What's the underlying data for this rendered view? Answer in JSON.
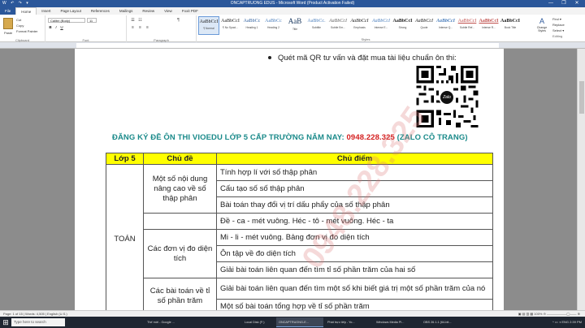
{
  "window": {
    "title": "ONCAPTRUONG EDUS  -  Microsoft Word (Product Activation Failed)",
    "quick_access": "W ↶ ↷ ▾",
    "min": "—",
    "max": "❐",
    "close": "✕"
  },
  "ribbon_tabs": [
    "File",
    "Home",
    "Insert",
    "Page Layout",
    "References",
    "Mailings",
    "Review",
    "View",
    "Foxit PDF"
  ],
  "ribbon": {
    "clipboard": {
      "label": "Clipboard",
      "paste": "Paste",
      "cut": "Cut",
      "copy": "Copy",
      "format_painter": "Format Painter"
    },
    "font": {
      "label": "Font",
      "name": "Calibri (Body)",
      "size": "11",
      "bold": "B",
      "italic": "I",
      "underline": "U"
    },
    "paragraph": {
      "label": "Paragraph"
    },
    "styles": {
      "label": "Styles",
      "items": [
        {
          "preview": "AaBbCcI",
          "name": "¶ Normal"
        },
        {
          "preview": "AaBbCcI",
          "name": "¶ No Spaci..."
        },
        {
          "preview": "AaBbCc",
          "name": "Heading 1"
        },
        {
          "preview": "AaBbCc",
          "name": "Heading 2"
        },
        {
          "preview": "AaB",
          "name": "Title"
        },
        {
          "preview": "AaBbCc.",
          "name": "Subtitle"
        },
        {
          "preview": "AaBbCcI",
          "name": "Subtle Em..."
        },
        {
          "preview": "AaBbCcI",
          "name": "Emphasis"
        },
        {
          "preview": "AaBbCcI",
          "name": "Intense E..."
        },
        {
          "preview": "AaBbCcI",
          "name": "Strong"
        },
        {
          "preview": "AaBbCcI",
          "name": "Quote"
        },
        {
          "preview": "AaBbCcI",
          "name": "Intense Q..."
        },
        {
          "preview": "AaBbCcI",
          "name": "Subtle Ref..."
        },
        {
          "preview": "AaBbCcI",
          "name": "Intense R..."
        },
        {
          "preview": "AaBbCcI",
          "name": "Book Title"
        }
      ],
      "change_styles": "Change Styles"
    },
    "editing": {
      "label": "Editing",
      "find": "Find ▾",
      "replace": "Replace",
      "select": "Select ▾"
    }
  },
  "document": {
    "bullet_text": "Quét mã QR tư vấn và đặt mua tài liệu chuẩn ôn thi:",
    "qr_logo": "Zalo",
    "headline_prefix": "ĐĂNG KÝ ĐỀ ÔN THI VIOEDU LỚP 5 CẤP TRƯỜNG NĂM NAY: ",
    "headline_phone": "0948.228.325",
    "headline_suffix": " (ZALO CÔ TRANG)",
    "watermark": "0948.228.325",
    "table": {
      "headers": [
        "Lớp 5",
        "Chủ đề",
        "Chủ điểm"
      ],
      "grade": "TOÁN",
      "topics": [
        "Một số nội dung nâng cao về số thập phân",
        "Các đơn vị đo diện tích",
        "Các bài toán về tỉ số phần trăm"
      ],
      "points": [
        "Tính hợp lí với số thập phân",
        "Cấu tạo số số thập phân",
        "Bài toán thay đổi vị trí dấu phẩy của số thập phân",
        "Đề - ca - mét vuông. Héc - tô - mét vuông. Héc - ta",
        "Mi - li - mét vuông. Bảng đơn vị đo diện tích",
        "Ôn tập về đo diện tích",
        "Giải bài toán liên quan đến tìm tỉ số phần trăm của hai số",
        "Giải bài toán liên quan đến tìm một số khi biết giá trị một số phần trăm của nó",
        "Một số bài toán tổng hợp về tỉ số phần trăm"
      ]
    }
  },
  "statusbar": {
    "left": "Page: 1 of 15   |   Words: 4,505   |   English (U.S.)",
    "right": "▣ ▤ ▥ ▦   100%  ⊖ ——————◯—— ⊕"
  },
  "taskbar": {
    "start": "⊞",
    "search": "Type here to search",
    "tasks": [
      "Thế mới - Google ...",
      "Local Disk (F:)",
      "ONCAPTRUONG-E...",
      "Phát trực tiếp - Yo...",
      "Windows Media Pl...",
      "OBS 26.1.1 (64-bit..."
    ],
    "tray": "^ ▭ ◑ ENG   2:39 PM"
  },
  "colors": {
    "word_blue": "#2b579a",
    "headline_teal": "#1a8a8a",
    "phone_red": "#d42020",
    "table_header_yellow": "#ffff00"
  }
}
